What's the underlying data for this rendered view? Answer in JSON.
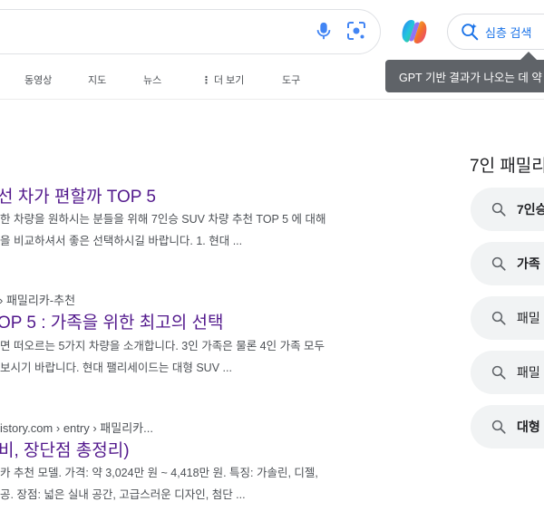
{
  "toolbar": {
    "deep_search_label": "심층 검색",
    "tooltip_text": "GPT 기반 결과가 나오는 데 약"
  },
  "tabs": [
    {
      "label": "동영상"
    },
    {
      "label": "지도"
    },
    {
      "label": "뉴스"
    },
    {
      "label": "더 보기"
    },
    {
      "label": "도구"
    }
  ],
  "results": [
    {
      "title": "선 차가 편할까 TOP 5",
      "snippet_lines": [
        "한 차량을 원하시는 분들을 위해 7인승 SUV 차량 추천 TOP 5 에 대해",
        "을 비교하셔서 좋은 선택하시길 바랍니다. 1. 현대 ..."
      ]
    },
    {
      "breadcrumb": "› 패밀리카-추천",
      "title": "OP 5 : 가족을 위한 최고의 선택",
      "snippet_lines": [
        "면 떠오르는 5가지 차량을 소개합니다. 3인 가족은 물론 4인 가족 모두",
        "보시기 바랍니다. 현대 팰리세이드는 대형 SUV ..."
      ]
    },
    {
      "breadcrumb": "istory.com › entry › 패밀리카...",
      "title": "비, 장단점 총정리)",
      "snippet_lines": [
        "카 추천 모델. 가격: 약 3,024만 원 ~ 4,418만 원. 특징: 가솔린, 디젤,",
        "공. 장점: 넓은 실내 공간, 고급스러운 디자인, 첨단 ..."
      ]
    }
  ],
  "related": {
    "heading": "7인 패밀리",
    "chips": [
      {
        "label": "7인승"
      },
      {
        "label": "가족"
      },
      {
        "label": "패밀"
      },
      {
        "label": "패밀"
      },
      {
        "label": "대형"
      }
    ]
  },
  "colors": {
    "link_visited": "#52188c",
    "accent_blue": "#1a73e8",
    "tooltip_bg": "#5f6368"
  }
}
